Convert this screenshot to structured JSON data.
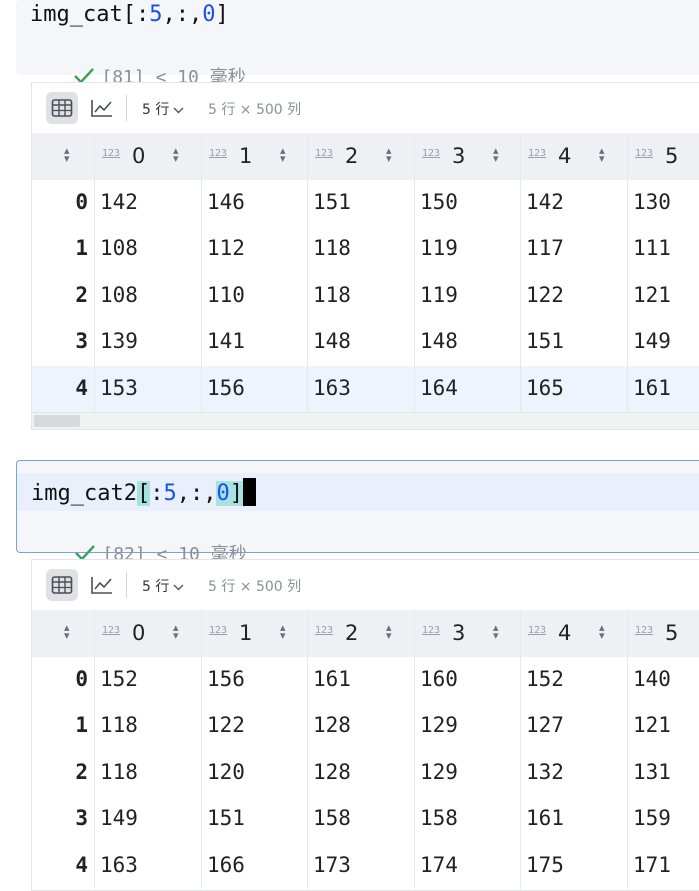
{
  "cells": [
    {
      "code_prefix": "img_cat[:",
      "code_num1": "5",
      "code_mid": ",:,",
      "code_num2": "0",
      "code_suffix": "]",
      "status": "[81] < 10 毫秒",
      "output": {
        "rows_label": "5 行",
        "dims": "5 行 × 500 列",
        "type_badge": "123",
        "columns": [
          "0",
          "1",
          "2",
          "3",
          "4",
          "5"
        ],
        "index": [
          "0",
          "1",
          "2",
          "3",
          "4"
        ],
        "rows": [
          [
            "142",
            "146",
            "151",
            "150",
            "142",
            "130"
          ],
          [
            "108",
            "112",
            "118",
            "119",
            "117",
            "111"
          ],
          [
            "108",
            "110",
            "118",
            "119",
            "122",
            "121"
          ],
          [
            "139",
            "141",
            "148",
            "148",
            "151",
            "149"
          ],
          [
            "153",
            "156",
            "163",
            "164",
            "165",
            "161"
          ]
        ]
      }
    },
    {
      "code_prefix": "img_cat2",
      "code_open": "[",
      "code_colon": ":",
      "code_num1": "5",
      "code_mid": ",:,",
      "code_num2": "0",
      "code_close": "]",
      "status": "[82] < 10 毫秒",
      "output": {
        "rows_label": "5 行",
        "dims": "5 行 × 500 列",
        "type_badge": "123",
        "columns": [
          "0",
          "1",
          "2",
          "3",
          "4",
          "5"
        ],
        "index": [
          "0",
          "1",
          "2",
          "3",
          "4"
        ],
        "rows": [
          [
            "152",
            "156",
            "161",
            "160",
            "152",
            "140"
          ],
          [
            "118",
            "122",
            "128",
            "129",
            "127",
            "121"
          ],
          [
            "118",
            "120",
            "128",
            "129",
            "132",
            "131"
          ],
          [
            "149",
            "151",
            "158",
            "158",
            "161",
            "159"
          ],
          [
            "163",
            "166",
            "173",
            "174",
            "175",
            "171"
          ]
        ]
      }
    }
  ]
}
